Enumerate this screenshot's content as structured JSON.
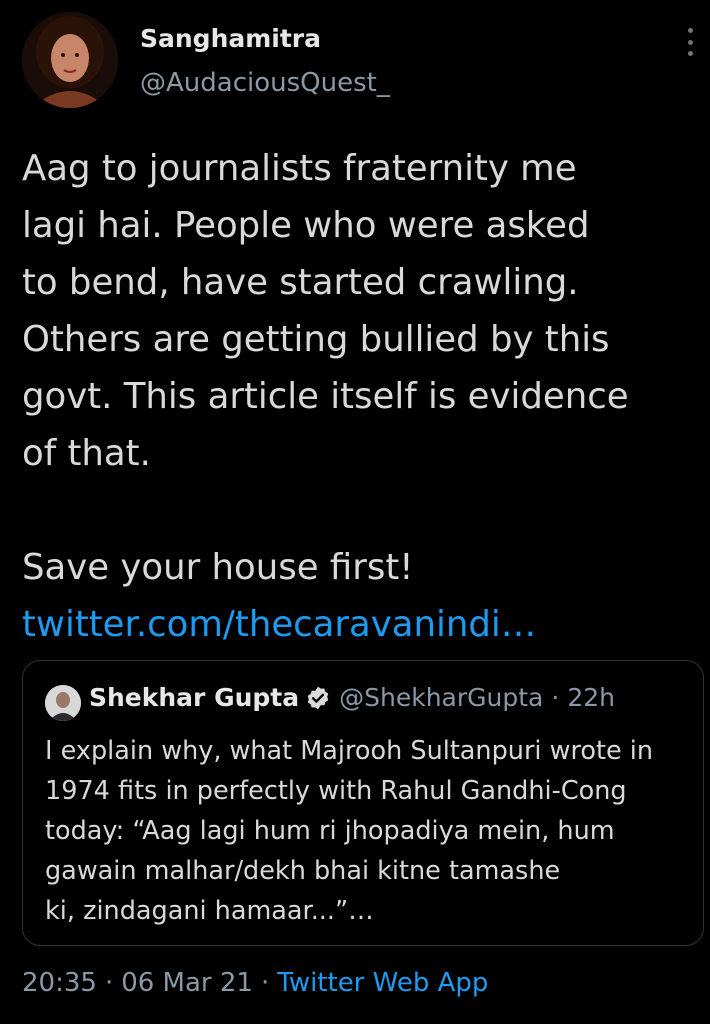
{
  "author": {
    "display_name": "Sanghamitra",
    "handle": "@AudaciousQuest_",
    "avatar_icon": "profile-photo"
  },
  "tweet": {
    "lines": [
      "Aag to journalists fraternity me",
      "lagi hai. People who were asked",
      "to bend, have started crawling.",
      "Others are getting bullied by this",
      "govt. This article itself is evidence",
      "of that."
    ],
    "closing": "Save your house first!",
    "link": "twitter.com/thecaravanindi…"
  },
  "quoted": {
    "display_name": "Shekhar Gupta",
    "handle": "@ShekharGupta",
    "separator": "·",
    "time": "22h",
    "lines": [
      "I explain why, what Majrooh Sultanpuri wrote in",
      "1974 fits in perfectly with Rahul Gandhi-Cong",
      "today: “Aag lagi hum ri jhopadiya mein, hum",
      "gawain malhar/dekh bhai kitne tamashe",
      "ki, zindagani hamaar...”…"
    ]
  },
  "footer": {
    "time": "20:35",
    "sep1": "·",
    "date": "06 Mar 21",
    "sep2": "·",
    "source": "Twitter Web App"
  },
  "colors": {
    "background": "#000000",
    "text": "#d9d9d9",
    "secondary": "#8b98a5",
    "link": "#1d9bf0",
    "border": "#2f3336"
  }
}
